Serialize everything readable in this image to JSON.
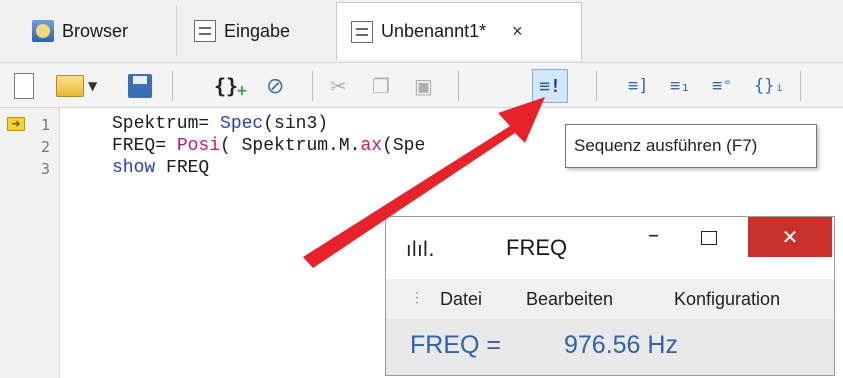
{
  "tabs": [
    {
      "label": "Browser",
      "icon": "browser-icon"
    },
    {
      "label": "Eingabe",
      "icon": "document-icon"
    },
    {
      "label": "Unbenannt1*",
      "icon": "document-icon",
      "active": true,
      "close": "×"
    }
  ],
  "toolbar": {
    "buttons": [
      "new-document-icon",
      "open-folder-icon",
      "save-icon",
      "braces-icon",
      "tag-icon",
      "cut-icon",
      "copy-icon",
      "paste-icon",
      "run-sequence-icon",
      "step-icon",
      "step-into-icon",
      "step-over-icon",
      "breakpoint-icon"
    ]
  },
  "tooltip": "Sequenz ausführen (F7)",
  "editor": {
    "lines": [
      {
        "num": "1",
        "prefix": "Spektrum= ",
        "kw": "Spec",
        "rest": "(sin3)"
      },
      {
        "num": "2",
        "prefix": "FREQ= ",
        "kw": "Posi",
        "rest": "( Spektrum.M.",
        "kw_b": "ax",
        "rest_b": "(Spe"
      },
      {
        "num": "3",
        "kw": "show",
        "rest": " FREQ"
      }
    ]
  },
  "freq_window": {
    "title": "FREQ",
    "min": "–",
    "close": "✕",
    "menu": [
      "Datei",
      "Bearbeiten",
      "Konfiguration"
    ],
    "value_label": "FREQ =",
    "value": "976.56 Hz"
  },
  "colors": {
    "annotation_arrow": "#e8222a",
    "value_text": "#2f61ad",
    "close_button": "#c9302c",
    "keyword_blue": "#2a3fbd",
    "keyword_pink": "#c51a6e"
  }
}
